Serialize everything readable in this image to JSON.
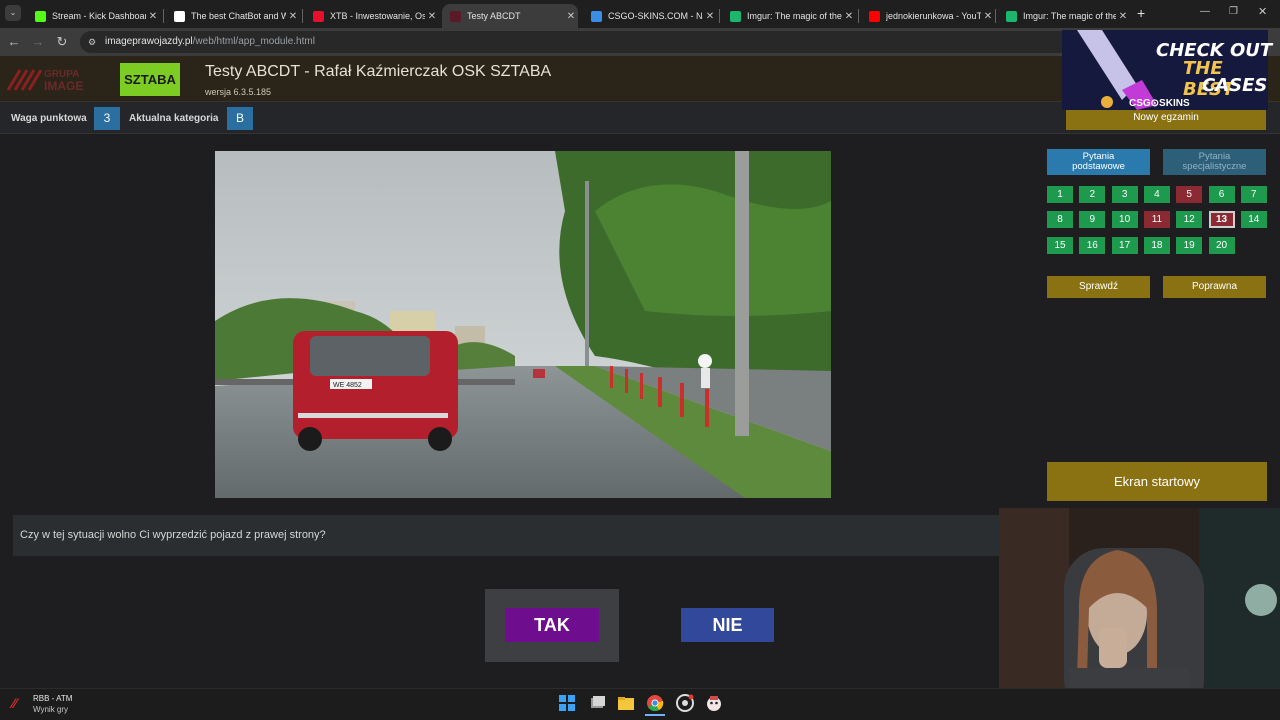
{
  "browser": {
    "tabs": [
      {
        "label": "Stream - Kick Dashboard",
        "icon": "kick-icon",
        "color": "#53fc18"
      },
      {
        "label": "The best ChatBot and Wi",
        "icon": "botrix-icon",
        "color": "#ffffff"
      },
      {
        "label": "XTB - Inwestowanie, Oszc",
        "icon": "xtb-icon",
        "color": "#e6102c"
      },
      {
        "label": "Testy ABCDT",
        "icon": "testy-icon",
        "color": "#5a1a2a"
      },
      {
        "label": "CSGO-SKINS.COM - Najle",
        "icon": "csgo-skins-icon",
        "color": "#3a8ee6"
      },
      {
        "label": "Imgur: The magic of the I",
        "icon": "imgur-icon",
        "color": "#1bb76e"
      },
      {
        "label": "jednokierunkowa - YouTu",
        "icon": "youtube-icon",
        "color": "#ff0000"
      },
      {
        "label": "Imgur: The magic of the I",
        "icon": "imgur-icon",
        "color": "#1bb76e"
      }
    ],
    "url_host": "imageprawojazdy.pl",
    "url_path": "/web/html/app_module.html"
  },
  "header": {
    "logo_text": "GRUPA IMAGE",
    "school_logo": "SZTABA",
    "title": "Testy ABCDT - Rafał Kaźmierczak OSK SZTABA",
    "version": "wersja 6.3.5.185"
  },
  "info": {
    "weight_label": "Waga punktowa",
    "weight_value": "3",
    "category_label": "Aktualna kategoria",
    "category_value": "B"
  },
  "question": {
    "text": "Czy w tej sytuacji wolno Ci wyprzedzić pojazd z prawej strony?",
    "yes_label": "TAK",
    "no_label": "NIE"
  },
  "panel": {
    "new_exam": "Nowy egzamin",
    "basic_tab": [
      "Pytania",
      "podstawowe"
    ],
    "special_tab": [
      "Pytania",
      "specjalistyczne"
    ],
    "questions": [
      {
        "n": "1",
        "state": "green"
      },
      {
        "n": "2",
        "state": "green"
      },
      {
        "n": "3",
        "state": "green"
      },
      {
        "n": "4",
        "state": "green"
      },
      {
        "n": "5",
        "state": "red"
      },
      {
        "n": "6",
        "state": "green"
      },
      {
        "n": "7",
        "state": "green"
      },
      {
        "n": "8",
        "state": "green"
      },
      {
        "n": "9",
        "state": "green"
      },
      {
        "n": "10",
        "state": "green"
      },
      {
        "n": "11",
        "state": "red"
      },
      {
        "n": "12",
        "state": "green"
      },
      {
        "n": "13",
        "state": "current"
      },
      {
        "n": "14",
        "state": "green"
      },
      {
        "n": "15",
        "state": "green"
      },
      {
        "n": "16",
        "state": "green"
      },
      {
        "n": "17",
        "state": "green"
      },
      {
        "n": "18",
        "state": "green"
      },
      {
        "n": "19",
        "state": "green"
      },
      {
        "n": "20",
        "state": "green"
      }
    ],
    "check": "Sprawdź",
    "correct": "Poprawna",
    "start_screen": "Ekran startowy"
  },
  "ad": {
    "line1": "CHECK OUT",
    "line2": "THE BEST",
    "line3": "CASES",
    "brand": "CSG⊙SKINS"
  },
  "video": {
    "plate": "WE 4852"
  },
  "taskbar": {
    "app_title": "RBB - ATM",
    "app_sub": "Wynik gry"
  }
}
